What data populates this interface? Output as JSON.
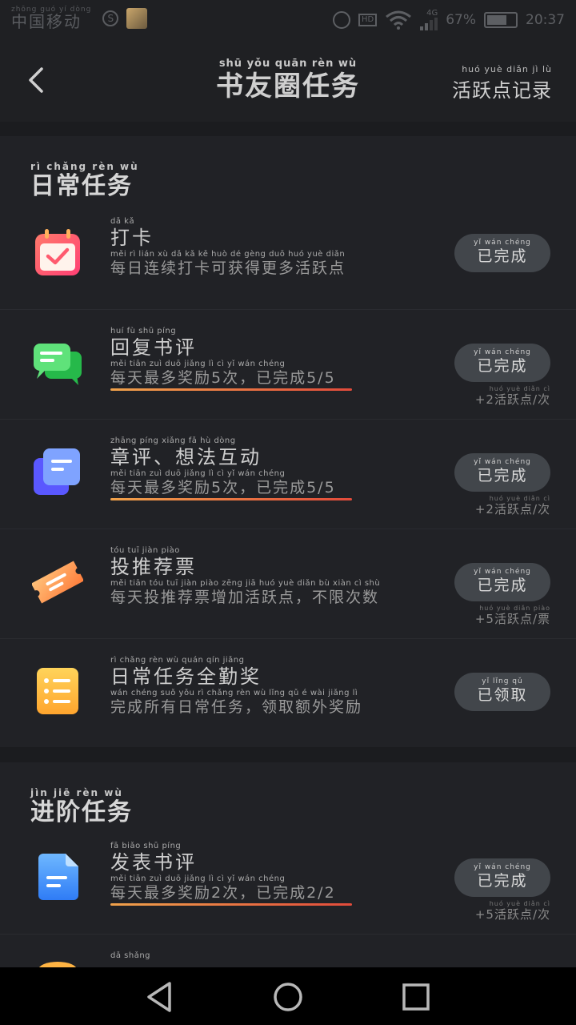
{
  "status_bar": {
    "carrier_pinyin": "zhōng guó  yí  dòng",
    "carrier": "中国移动",
    "battery": "67%",
    "network": "4G",
    "hd": "HD",
    "time": "20:37"
  },
  "header": {
    "title_pinyin": "shū  yǒu quān rèn  wù",
    "title": "书友圈任务",
    "records_pinyin": "huó  yuè  diǎn  jì   lù",
    "records": "活跃点记录"
  },
  "daily_section": {
    "title_pinyin": "rì chǎng rèn  wù",
    "title": "日常任务",
    "tasks": [
      {
        "title_pinyin": "dǎ   kǎ",
        "title": "打卡",
        "desc_pinyin": "měi  rì   lián  xù  dǎ  kǎ  kě  huò  dé  gèng  duō  huó  yuè  diǎn",
        "desc": "每日连续打卡可获得更多活跃点",
        "button_pinyin": "yǐ  wán chéng",
        "button": "已完成",
        "reward_pinyin": "",
        "reward": "",
        "icon": "calendar-check-icon"
      },
      {
        "title_pinyin": "huí   fù   shū  píng",
        "title": "回复书评",
        "desc_pinyin": "měi tiān  zuì  duō jiǎng  lì        cì       yǐ  wán chéng",
        "desc": "每天最多奖励5次，已完成5/5",
        "button_pinyin": "yǐ  wán chéng",
        "button": "已完成",
        "reward_pinyin": "huó yuè diǎn  cì",
        "reward": "+2活跃点/次",
        "icon": "chat-bubbles-icon"
      },
      {
        "title_pinyin": "zhāng píng    xiǎng  fǎ   hù  dòng",
        "title": "章评、想法互动",
        "desc_pinyin": "měi tiān  zuì  duō jiǎng  lì        cì       yǐ  wán chéng",
        "desc": "每天最多奖励5次，已完成5/5",
        "button_pinyin": "yǐ  wán chéng",
        "button": "已完成",
        "reward_pinyin": "huó yuè diǎn  cì",
        "reward": "+2活跃点/次",
        "icon": "stacked-cards-icon"
      },
      {
        "title_pinyin": "tóu  tuī  jiàn piào",
        "title": "投推荐票",
        "desc_pinyin": "měi tiān tóu  tuī  jiàn piào zēng jiā huó yuè diǎn      bù  xiàn  cì  shù",
        "desc": "每天投推荐票增加活跃点，不限次数",
        "button_pinyin": "yǐ  wán chéng",
        "button": "已完成",
        "reward_pinyin": "huó yuè diǎn piào",
        "reward": "+5活跃点/票",
        "icon": "ticket-icon"
      },
      {
        "title_pinyin": "rì chǎng rèn  wù  quán qín jiǎng",
        "title": "日常任务全勤奖",
        "desc_pinyin": "wán chéng suǒ yǒu  rì chǎng rèn  wù      lǐng  qǔ   é   wài jiǎng  lì",
        "desc": "完成所有日常任务，领取额外奖励",
        "button_pinyin": "yǐ  lǐng  qǔ",
        "button": "已领取",
        "reward_pinyin": "",
        "reward": "",
        "icon": "checklist-icon"
      }
    ]
  },
  "advanced_section": {
    "title_pinyin": "jìn  jiē  rèn  wù",
    "title": "进阶任务",
    "tasks": [
      {
        "title_pinyin": "fā  biǎo  shū  píng",
        "title": "发表书评",
        "desc_pinyin": "měi tiān  zuì  duō jiǎng  lì        cì       yǐ  wán chéng",
        "desc": "每天最多奖励2次，已完成2/2",
        "button_pinyin": "yǐ  wán chéng",
        "button": "已完成",
        "reward_pinyin": "huó yuè diǎn  cì",
        "reward": "+5活跃点/次",
        "icon": "document-icon"
      },
      {
        "title_pinyin": "dǎ  shǎng",
        "title": "",
        "icon": "coin-icon"
      }
    ]
  },
  "colors": {
    "background": "#1b1c1f",
    "card": "#212226",
    "button": "#42464b",
    "progress_start": "#f0a24b",
    "progress_end": "#e24b3b"
  }
}
